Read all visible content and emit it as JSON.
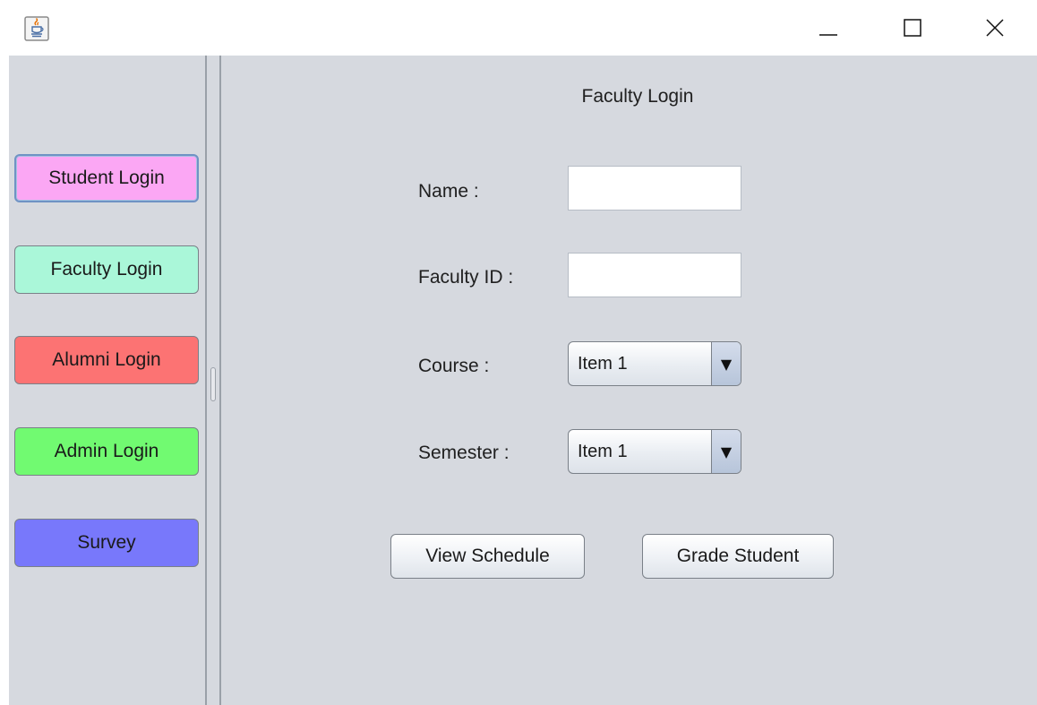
{
  "window": {
    "app_icon": "java-cup-icon",
    "controls": {
      "minimize_icon": "minimize-icon",
      "maximize_icon": "maximize-icon",
      "close_icon": "close-icon"
    }
  },
  "sidebar": {
    "buttons": [
      {
        "label": "Student Login",
        "color": "#fba7f4",
        "focused": true
      },
      {
        "label": "Faculty Login",
        "color": "#aaf7d9"
      },
      {
        "label": "Alumni Login",
        "color": "#fc7373"
      },
      {
        "label": "Admin Login",
        "color": "#71fa71"
      },
      {
        "label": "Survey",
        "color": "#7878fb"
      }
    ]
  },
  "form": {
    "title": "Faculty Login",
    "name_label": "Name :",
    "name_value": "",
    "faculty_id_label": "Faculty ID :",
    "faculty_id_value": "",
    "course_label": "Course :",
    "course_value": "Item 1",
    "semester_label": "Semester :",
    "semester_value": "Item 1",
    "dropdown_arrow": "▼",
    "view_schedule_label": "View Schedule",
    "grade_student_label": "Grade Student"
  }
}
